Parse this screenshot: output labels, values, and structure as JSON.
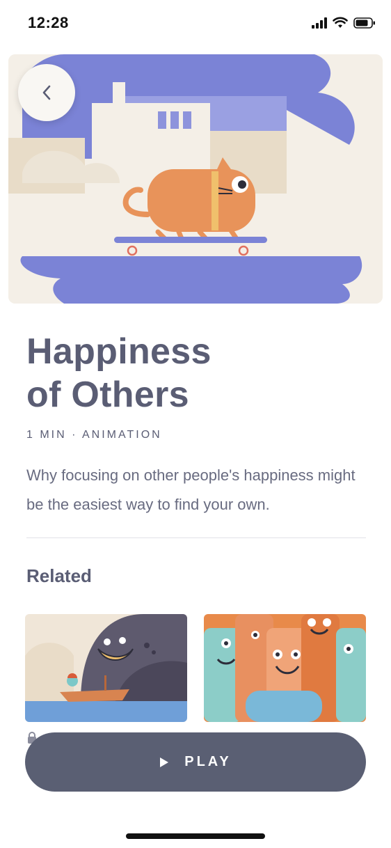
{
  "status_bar": {
    "time": "12:28",
    "icons": [
      "cellular-signal-icon",
      "wifi-icon",
      "battery-icon"
    ]
  },
  "hero": {
    "illustration": "skateboarding-cat-illustration",
    "back_icon": "chevron-left-icon"
  },
  "content": {
    "title_line1": "Happiness",
    "title_line2": "of Others",
    "meta": "1 MIN · ANIMATION",
    "description": "Why focusing on other people's happiness might be the easiest way to find your own."
  },
  "related": {
    "heading": "Related",
    "items": [
      {
        "illustration": "whale-and-boat-illustration"
      },
      {
        "illustration": "smiling-crowd-illustration"
      }
    ]
  },
  "play_button": {
    "label": "PLAY",
    "icon": "play-icon"
  },
  "colors": {
    "text": "#5a5d74",
    "button": "#5a5f73",
    "hero_purple": "#7b83d6",
    "cat_orange": "#e8935a",
    "background": "#ffffff"
  }
}
